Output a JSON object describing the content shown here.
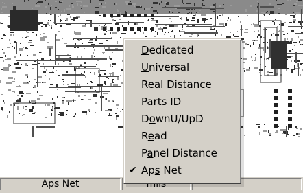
{
  "menu": {
    "items": [
      {
        "label": "Dedicated",
        "mnemonic": 0,
        "checked": false
      },
      {
        "label": "Universal",
        "mnemonic": 0,
        "checked": false
      },
      {
        "label": "Real Distance",
        "mnemonic": 0,
        "checked": false
      },
      {
        "label": "Parts ID",
        "mnemonic": 0,
        "checked": false
      },
      {
        "label": "DownU/UpD",
        "mnemonic": 1,
        "checked": false
      },
      {
        "label": "Read",
        "mnemonic": 1,
        "checked": false
      },
      {
        "label": "Panel Distance",
        "mnemonic": 1,
        "checked": false
      },
      {
        "label": "Aps Net",
        "mnemonic": 2,
        "checked": true
      }
    ],
    "check_glyph": "✔"
  },
  "status_bar": {
    "cells": [
      {
        "text": "Aps Net"
      },
      {
        "text": "mils"
      }
    ]
  },
  "colors": {
    "face": "#d4d0c8",
    "pcb_ink": "#404040"
  }
}
